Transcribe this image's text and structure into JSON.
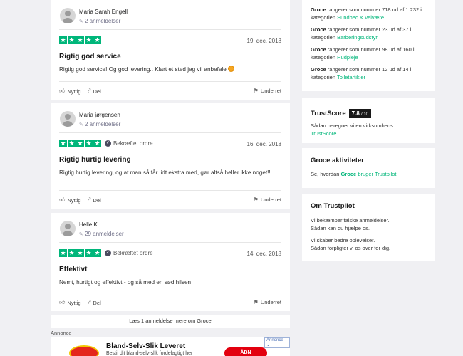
{
  "reviews": [
    {
      "name": "Maria Sarah Engell",
      "count": "2 anmeldelser",
      "verified": "",
      "date": "19. dec. 2018",
      "title": "Rigtig god service",
      "body": "Rigtig god service! Og god levering.. Klart et sted jeg vil anbefale",
      "helpful": "Nyttig",
      "share": "Del",
      "report": "Underret"
    },
    {
      "name": "Maria jørgensen",
      "count": "2 anmeldelser",
      "verified": "Bekræftet ordre",
      "date": "16. dec. 2018",
      "title": "Rigtig hurtig levering",
      "body": "Rigtig hurtig levering, og at man så får lidt ekstra med, gør altså heller ikke noget!!",
      "helpful": "Nyttig",
      "share": "Del",
      "report": "Underret"
    },
    {
      "name": "Helle K",
      "count": "29 anmeldelser",
      "verified": "Bekræftet ordre",
      "date": "14. dec. 2018",
      "title": "Effektivt",
      "body": "Nemt, hurtigt og effektivt - og så med en sød hilsen",
      "helpful": "Nyttig",
      "share": "Del",
      "report": "Underret"
    }
  ],
  "more_reviews": "Læs 1 anmeldelse mere om Groce",
  "ad": {
    "label": "Annonce",
    "tag": "Annonce",
    "title": "Bland-Selv-Slik Leveret",
    "subtitle": "Bestil dit bland-selv-slik fordelagtigt her",
    "button": "ÅBN"
  },
  "rankings": [
    {
      "company": "Groce",
      "text": "rangerer som nummer 718 ud af 1.232 i kategorien",
      "category": "Sundhed & velvære"
    },
    {
      "company": "Groce",
      "text": "rangerer som nummer 23 ud af 37 i kategorien",
      "category": "Barberingsudstyr"
    },
    {
      "company": "Groce",
      "text": "rangerer som nummer 98 ud af 160 i kategorien",
      "category": "Hudpleje"
    },
    {
      "company": "Groce",
      "text": "rangerer som nummer 12 ud af 14 i kategorien",
      "category": "Toiletartikler"
    }
  ],
  "trustscore": {
    "title": "TrustScore",
    "score": "7.8",
    "scale": "/ 10",
    "text": "Sådan beregner vi en virksomheds",
    "link": "TrustScore."
  },
  "activities": {
    "title": "Groce aktiviteter",
    "pre": "Se, hvordan",
    "company": "Groce",
    "post": "bruger Trustpilot"
  },
  "about": {
    "title": "Om Trustpilot",
    "line1": "Vi bekæmper falske anmeldelser.",
    "link1": "Sådan kan du hjælpe os.",
    "line2": "Vi skaber bedre oplevelser.",
    "link2": "Sådan forpligter vi os over for dig."
  },
  "colors": {
    "star": "#00b67a",
    "link": "#00b67a",
    "background": "#f0f0f3"
  }
}
